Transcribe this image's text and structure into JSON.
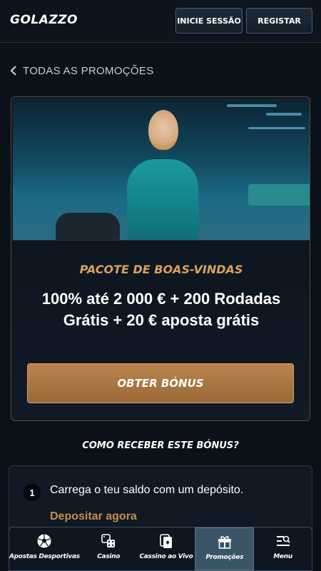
{
  "header": {
    "logo": "GOLAZZO",
    "login_label": "INICIE SESSÃO",
    "register_label": "REGISTAR"
  },
  "back_link": {
    "label": "TODAS AS PROMOÇÕES",
    "icon": "chevron-left-icon"
  },
  "promo": {
    "title": "PACOTE DE BOAS-VINDAS",
    "description": "100% até 2 000 € + 200 Rodadas Grátis + 20 € aposta grátis",
    "cta_label": "OBTER BÓNUS"
  },
  "how_to": {
    "title": "COMO RECEBER ESTE BÓNUS?",
    "steps": [
      {
        "number": "1",
        "text": "Carrega o teu saldo com um depósito.",
        "link": "Depositar agora"
      }
    ]
  },
  "bottom_nav": {
    "items": [
      {
        "label": "Apostas Desportivas",
        "icon": "soccer-ball-icon"
      },
      {
        "label": "Casino",
        "icon": "dice-icon"
      },
      {
        "label": "Cassino ao Vivo",
        "icon": "cards-icon"
      },
      {
        "label": "Promoções",
        "icon": "gift-icon"
      },
      {
        "label": "Menu",
        "icon": "menu-search-icon"
      }
    ],
    "active_index": 3
  },
  "colors": {
    "background": "#0b1119",
    "accent_gold": "#d9a060",
    "cta_gold": "#b9844e",
    "nav_active": "#3a5468"
  }
}
